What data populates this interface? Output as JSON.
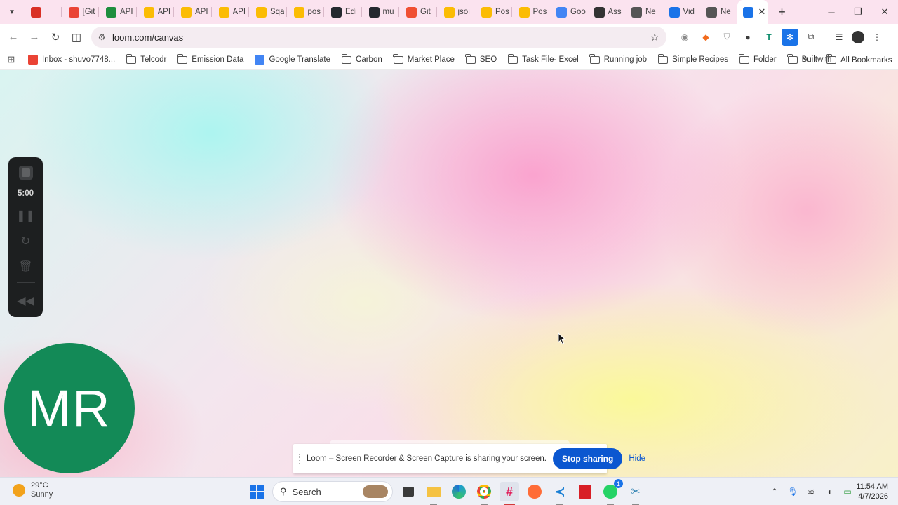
{
  "browser": {
    "tabs": [
      {
        "title": "",
        "favicon": "record-icon",
        "color": "#d93025"
      },
      {
        "title": "[Git",
        "favicon": "gmail-icon",
        "color": "#ea4335"
      },
      {
        "title": "API",
        "favicon": "classroom-icon",
        "color": "#1e8e3e"
      },
      {
        "title": "API",
        "favicon": "google-drive-icon",
        "color": "#fbbc04"
      },
      {
        "title": "API",
        "favicon": "google-drive-icon",
        "color": "#fbbc04"
      },
      {
        "title": "API",
        "favicon": "google-drive-icon",
        "color": "#fbbc04"
      },
      {
        "title": "Sqa",
        "favicon": "google-drive-icon",
        "color": "#fbbc04"
      },
      {
        "title": "pos",
        "favicon": "google-drive-icon",
        "color": "#fbbc04"
      },
      {
        "title": "Edi",
        "favicon": "github-icon",
        "color": "#24292f"
      },
      {
        "title": "mu",
        "favicon": "github-icon",
        "color": "#24292f"
      },
      {
        "title": "Git",
        "favicon": "git-icon",
        "color": "#f05033"
      },
      {
        "title": "jsoi",
        "favicon": "google-drive-icon",
        "color": "#fbbc04"
      },
      {
        "title": "Pos",
        "favicon": "google-drive-icon",
        "color": "#fbbc04"
      },
      {
        "title": "Pos",
        "favicon": "google-drive-icon",
        "color": "#fbbc04"
      },
      {
        "title": "Goo",
        "favicon": "google-translate-icon",
        "color": "#4285f4"
      },
      {
        "title": "Ass",
        "favicon": "openai-icon",
        "color": "#333333"
      },
      {
        "title": "Ne",
        "favicon": "globe-icon",
        "color": "#555555"
      },
      {
        "title": "Vid",
        "favicon": "loom-icon",
        "color": "#1a73e8"
      },
      {
        "title": "Ne",
        "favicon": "globe-icon",
        "color": "#555555"
      }
    ],
    "active_tab": {
      "title": "",
      "favicon": "loom-icon",
      "color": "#1a73e8",
      "close": "✕"
    },
    "new_tab": "+",
    "address": "loom.com/canvas",
    "bookmarks": [
      {
        "label": "Inbox - shuvo7748...",
        "icon": "gmail-icon"
      },
      {
        "label": "Telcodr",
        "icon": "folder-icon"
      },
      {
        "label": "Emission Data",
        "icon": "folder-icon"
      },
      {
        "label": "Google Translate",
        "icon": "google-translate-icon"
      },
      {
        "label": "Carbon",
        "icon": "folder-icon"
      },
      {
        "label": "Market Place",
        "icon": "folder-icon"
      },
      {
        "label": "SEO",
        "icon": "folder-icon"
      },
      {
        "label": "Task File- Excel",
        "icon": "folder-icon"
      },
      {
        "label": "Running job",
        "icon": "folder-icon"
      },
      {
        "label": "Simple Recipes",
        "icon": "folder-icon"
      },
      {
        "label": "Folder",
        "icon": "folder-icon"
      },
      {
        "label": "Builtwith",
        "icon": "folder-icon"
      }
    ],
    "more_bookmarks": "»",
    "all_bookmarks": "All Bookmarks"
  },
  "loom": {
    "timer": "5:00",
    "avatar_initials": "MR",
    "avatar_color": "#138a57",
    "share_message": "Loom – Screen Recorder & Screen Capture is sharing your screen.",
    "stop_sharing": "Stop sharing",
    "hide": "Hide"
  },
  "taskbar": {
    "weather_temp": "29°C",
    "weather_condition": "Sunny",
    "search_label": "Search",
    "time": "11:54 AM",
    "date": "4/7/2026",
    "whatsapp_badge": "1"
  }
}
